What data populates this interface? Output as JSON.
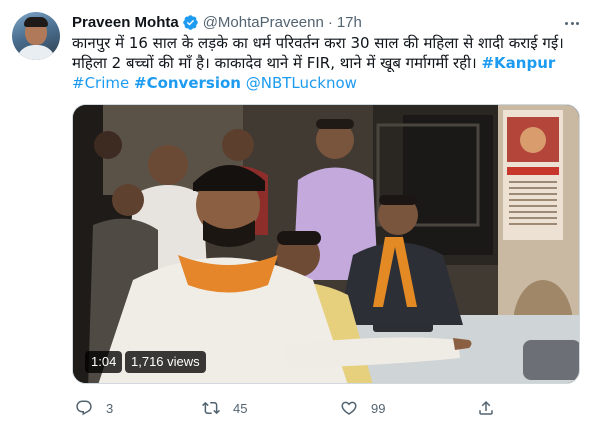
{
  "tweet": {
    "author": {
      "name": "Praveen Mohta",
      "handle": "@MohtaPraveenn",
      "separator": "·",
      "time": "17h",
      "verified": true
    },
    "text": {
      "line1": "कानपुर में 16 साल के लड़के का धर्म परिवर्तन करा 30 साल की महिला से शादी कराई गई।",
      "line2_text": "महिला 2 बच्चों की माँ है। काकादेव थाने में FIR, थाने में खूब गर्मागर्मी रही। ",
      "hashtag_kanpur": "#Kanpur",
      "hashtag_crime": "#Crime",
      "hashtag_conversion": "#Conversion",
      "mention": "@NBTLucknow"
    },
    "media": {
      "type": "video",
      "duration": "1:04",
      "views": "1,716 views"
    },
    "actions": {
      "replies": "3",
      "retweets": "45",
      "likes": "99"
    },
    "colors": {
      "link": "#1d9bf0",
      "secondary_text": "#536471",
      "border": "#cfd9de"
    },
    "icons": [
      "verified-badge-icon",
      "more-icon",
      "reply-icon",
      "retweet-icon",
      "like-icon",
      "share-icon"
    ]
  }
}
